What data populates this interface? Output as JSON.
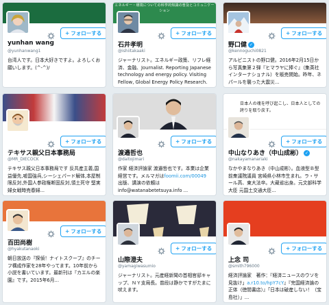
{
  "follow_label": "フォローする",
  "follow_plus": "+",
  "colors": {
    "accent": "#1da1f2",
    "link": "#1b95e0"
  },
  "cards": [
    {
      "name": "yunhan wang",
      "handle": "@yunhanwang1",
      "bio": "台湾人です。日本大好きですよ。よろしくお願いします。(^-^)/",
      "banner_color": "#1b6c3f",
      "banner_text": ""
    },
    {
      "name": "石井孝明",
      "handle": "@ishiitakaaki",
      "bio": "ジャーナリスト。エネルギー政策、リフレ経済、金融、Journalist. Reporting Japanese technology and energy policy. Visiting Fellow, Global Energy Policy Research.",
      "banner_color": "#2d8a4e",
      "banner_text": "エネルギー・環境についての科学的知識の普及とコミュニケーション"
    },
    {
      "name": "野口健",
      "handle": "@kennoguchi0821",
      "bio": "アルピニストの野口健。2016年2月15日から写真集第２弾『ヒマラヤに捧ぐ』（集英社インターナショナル）を販売開始。昨年、ネパールを襲った大震災...",
      "banner_color": "#5b3a2a",
      "banner_text": ""
    },
    {
      "name": "テキサス親父日本事務局",
      "handle": "@MR_DIECOCK",
      "bio": "テキサス親父日本事務局です 反共産主義,国益優先,嘘国強兵,シーシェパード解体,本屋制限反対,外国人参政権断固反対,領土死守 堅実婦女戦時売春婦...",
      "banner_color": "#b23c3c",
      "banner_text": ""
    },
    {
      "name": "渡邉哲也",
      "handle": "@daitojimari",
      "bio": "作家 経済評論家 渡邉哲也です。本業は企業経営です。メルマガは",
      "bio_link": "foomii.com/00049",
      "bio_after": " 出版、講演の依頼は info@watanabetetsuya.info ...",
      "banner_color": "#dddddd",
      "banner_text": ""
    },
    {
      "name": "中山なりあき（中山成彬）",
      "handle": "@nakayamanariaki",
      "bio": "なかやまなりあき（中山成彬）。血液型Ｂ型 前衆議院議員 宮崎県小林市生まれ。ラ・サール高、東大法卒。大蔵省出身。元文部科学大臣 元国土交通大臣...",
      "banner_color": "#ffffff",
      "banner_text": "日本人の魂を呼び起こし、日本人としての誇りを取り戻す。"
    },
    {
      "name": "百田尚樹",
      "handle": "@hyakutanaoki",
      "bio": "朝日放送の『探偵！ナイトスクープ』のチーフ構成作家を28年やってます。10年前から小説を書いています。最新刊は『カエルの楽園』です。2015年6月...",
      "banner_color": "#e8743b",
      "banner_text": ""
    },
    {
      "name": "山際澄夫",
      "handle": "@yamagiwasumio",
      "bio": "ジャーナリスト。元産経新聞の首相官邸キャップ、ＮＹ支局長。普段は静かですがたまに吠えます。",
      "banner_color": "#2a2a3a",
      "banner_text": ""
    },
    {
      "name": "上念 司",
      "handle": "@smith796000",
      "bio": "経済評論家　著作：『経済ニュースのウソを見抜け」",
      "bio_link": "a.r10.to/hpY7cY",
      "bio_after": "』『完国経済論の正体（徳間書店）』「日本は破産しない！（宝島社）」...",
      "banner_color": "#e53e1f",
      "banner_text": ""
    }
  ]
}
